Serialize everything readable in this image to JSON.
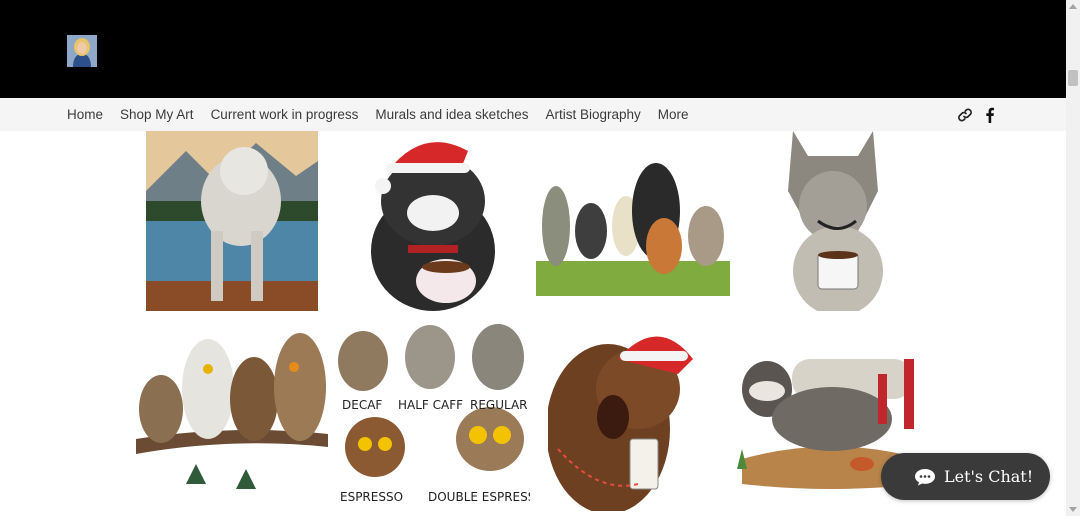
{
  "header": {
    "avatar_icon": "profile-photo-icon",
    "background": "#000000"
  },
  "nav": {
    "items": [
      {
        "label": "Home"
      },
      {
        "label": "Shop My Art"
      },
      {
        "label": "Current work in progress"
      },
      {
        "label": "Murals and idea sketches"
      },
      {
        "label": "Artist Biography"
      },
      {
        "label": "More"
      }
    ],
    "social": [
      {
        "icon": "link-icon"
      },
      {
        "icon": "facebook-icon"
      }
    ]
  },
  "gallery": {
    "rows": [
      [
        {
          "subject": "shaggy-dog-mountain-lake-painting-icon"
        },
        {
          "subject": "black-cat-santa-hat-coffee-icon"
        },
        {
          "subject": "animal-bluegrass-band-icon"
        },
        {
          "subject": "wolf-with-coffee-mug-icon"
        }
      ],
      [
        {
          "subject": "owls-on-branch-with-coffee-icon"
        },
        {
          "subject": "owl-coffee-chart-icon",
          "captions": [
            "DECAF",
            "HALF CAFF",
            "REGULAR",
            "ESPRESSO",
            "DOUBLE ESPRESSO"
          ]
        },
        {
          "subject": "roaring-bear-santa-hat-coffee-icon"
        },
        {
          "subject": "raccoon-lounging-on-log-icon"
        }
      ]
    ]
  },
  "chat": {
    "label": "Let's Chat!",
    "icon": "chat-bubble-icon",
    "color": "#3a3a3a"
  }
}
